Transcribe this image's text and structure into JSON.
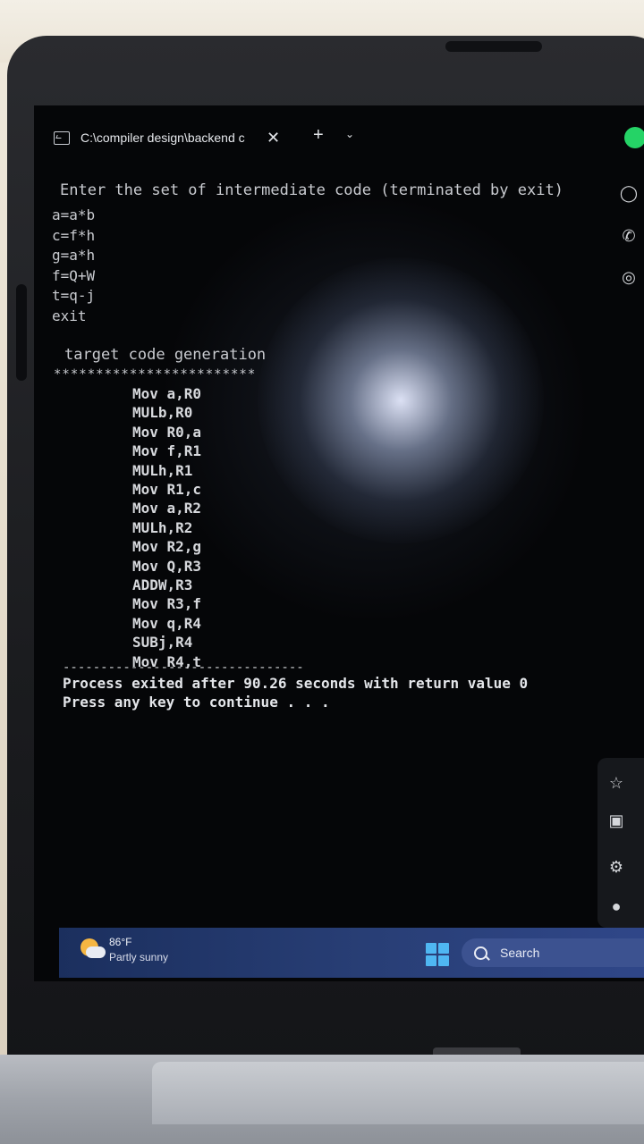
{
  "terminal": {
    "tab_title": "C:\\compiler design\\backend c",
    "tab_close": "✕",
    "new_tab": "+",
    "dropdown": "⌄",
    "prompt": "Enter the set of intermediate code (terminated by exit)",
    "inputs": [
      "a=a*b",
      "c=f*h",
      "g=a*h",
      "f=Q+W",
      "t=q-j",
      "exit"
    ],
    "section_title": "target code generation",
    "stars": "************************",
    "code": [
      "Mov a,R0",
      "MULb,R0",
      "Mov R0,a",
      "Mov f,R1",
      "MULh,R1",
      "Mov R1,c",
      "Mov a,R2",
      "MULh,R2",
      "Mov R2,g",
      "Mov Q,R3",
      "ADDW,R3",
      "Mov R3,f",
      "Mov q,R4",
      "SUBj,R4",
      "Mov R4,t"
    ],
    "dashes": "--------------------------------",
    "exit_message": "Process exited after 90.26 seconds with return value 0",
    "continue_message": "Press any key to continue . . ."
  },
  "taskbar": {
    "temperature": "86°F",
    "condition": "Partly sunny",
    "search_label": "Search"
  },
  "icons": {
    "side": [
      "chat-icon",
      "phone-icon",
      "circle-icon"
    ],
    "panel": [
      "star-icon",
      "archive-icon",
      "settings-icon",
      "avatar-icon"
    ]
  }
}
